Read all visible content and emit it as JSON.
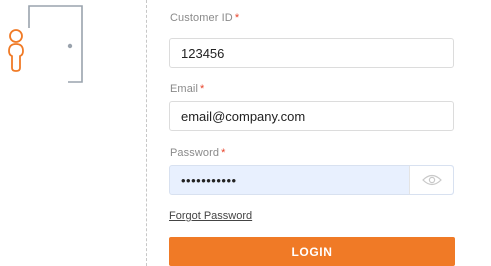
{
  "illustration": {
    "icon": "door-person-icon",
    "colors": {
      "door": "#9aa3ad",
      "person": "#f07a26"
    }
  },
  "form": {
    "customer_id": {
      "label": "Customer ID",
      "required_mark": "*",
      "value": "123456"
    },
    "email": {
      "label": "Email",
      "required_mark": "*",
      "value": "email@company.com"
    },
    "password": {
      "label": "Password",
      "required_mark": "*",
      "masked_value": "•••••••••••",
      "toggle_icon": "eye-icon"
    },
    "forgot_password_label": "Forgot Password",
    "login_label": "LOGIN"
  },
  "colors": {
    "accent": "#f07a26",
    "required": "#e8432a",
    "autofill_bg": "#e8f0fe"
  }
}
